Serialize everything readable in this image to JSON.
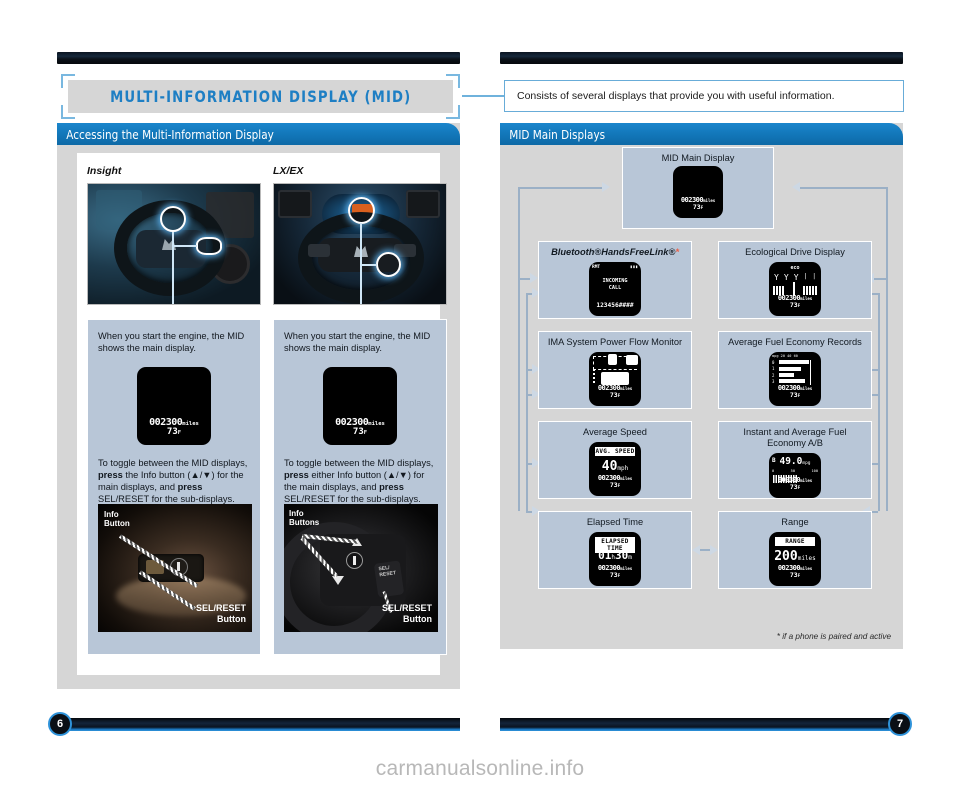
{
  "document": {
    "watermark": "carmanualsonline.info",
    "left_page_number": "6",
    "right_page_number": "7"
  },
  "left_page": {
    "title": "MULTI-INFORMATION DISPLAY (MID)",
    "panel_title": "Accessing the Multi-Information Display",
    "columns": [
      {
        "label": "Insight",
        "photo_alt": "insight-steering-wheel",
        "intro": "When you start the engine, the MID shows the main display.",
        "mid_screen": {
          "odometer": "002300",
          "odometer_unit": "miles",
          "temperature": "73",
          "temperature_unit": "F"
        },
        "toggle_text_parts": [
          "To toggle between the MID displays, ",
          "press",
          " the Info button (▲/▼) for the main displays, and ",
          "press",
          " SEL/RESET for the sub-displays."
        ],
        "button_photo": {
          "info_label_line1": "Info",
          "info_label_line2": "Button",
          "selreset_label_line1": "SEL/RESET",
          "selreset_label_line2": "Button"
        }
      },
      {
        "label": "LX/EX",
        "photo_alt": "lx-ex-steering-wheel",
        "intro": "When you start the engine, the MID shows the main display.",
        "mid_screen": {
          "odometer": "002300",
          "odometer_unit": "miles",
          "temperature": "73",
          "temperature_unit": "F"
        },
        "toggle_text_parts": [
          "To toggle between the MID displays, ",
          "press",
          " either Info button (▲/▼) for the main displays, and ",
          "press",
          " SEL/RESET for the sub-displays."
        ],
        "button_photo": {
          "info_label_line1": "Info",
          "info_label_line2": "Buttons",
          "selreset_label_line1": "SEL/RESET",
          "selreset_label_line2": "Button"
        }
      }
    ]
  },
  "right_page": {
    "callout": "Consists of several displays that provide you with useful information.",
    "panel_title": "MID Main Displays",
    "footnote": "* if a phone is paired and active",
    "main_display": {
      "caption": "MID Main Display",
      "odometer": "002300",
      "odometer_unit": "miles",
      "temperature": "73",
      "temperature_unit": "F"
    },
    "displays": [
      {
        "caption": "Bluetooth®HandsFreeLink®",
        "caption_star": "*",
        "italic_word": "Bluetooth",
        "screen": {
          "status_left": "RMT",
          "line1": "INCOMING",
          "line2": "CALL",
          "line3": "123456####"
        }
      },
      {
        "caption": "Ecological Drive Display",
        "screen": {
          "label": "eco",
          "odometer": "002300",
          "odometer_unit": "miles",
          "temperature": "73",
          "temperature_unit": "F"
        }
      },
      {
        "caption": "IMA System Power Flow Monitor",
        "screen": {
          "odometer": "002300",
          "odometer_unit": "miles",
          "temperature": "73",
          "temperature_unit": "F"
        }
      },
      {
        "caption": "Average Fuel Economy Records",
        "screen": {
          "axis": "mpg   20 40 60",
          "rows": [
            "0",
            "1",
            "2",
            "3"
          ],
          "odometer": "002300",
          "odometer_unit": "miles",
          "temperature": "73",
          "temperature_unit": "F"
        }
      },
      {
        "caption": "Average Speed",
        "screen": {
          "title": "AVG. SPEED",
          "value": "40",
          "unit": "mph",
          "odometer": "002300",
          "odometer_unit": "miles",
          "temperature": "73",
          "temperature_unit": "F"
        }
      },
      {
        "caption": "Instant and Average Fuel Economy A/B",
        "screen": {
          "mode": "B",
          "value": "49.0",
          "unit": "mpg",
          "scale": [
            "0",
            "50",
            "100"
          ],
          "odometer": "002300",
          "odometer_unit": "miles",
          "temperature": "73",
          "temperature_unit": "F"
        }
      },
      {
        "caption": "Elapsed Time",
        "screen": {
          "title": "ELAPSED TIME",
          "hours": "01",
          "hours_unit": "h",
          "minutes": "30",
          "minutes_unit": "m",
          "odometer": "002300",
          "odometer_unit": "miles",
          "temperature": "73",
          "temperature_unit": "F"
        }
      },
      {
        "caption": "Range",
        "screen": {
          "title": "RANGE",
          "value": "200",
          "unit": "miles",
          "odometer": "002300",
          "odometer_unit": "miles",
          "temperature": "73",
          "temperature_unit": "F"
        }
      }
    ]
  },
  "colors": {
    "accent_blue": "#1b86cc",
    "title_blue": "#1e7fc4",
    "panel_gray": "#d6d6d6",
    "card_blue_gray": "#b8c6d7",
    "star_red": "#e8614a"
  }
}
